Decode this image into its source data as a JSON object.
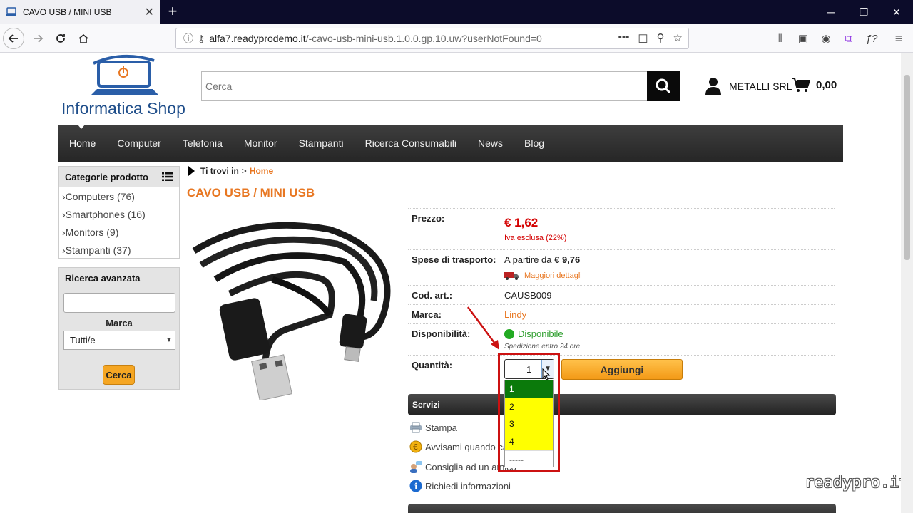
{
  "browser": {
    "tab_title": "CAVO USB / MINI USB",
    "tab_close": "✕",
    "new_tab": "+",
    "url_host": "alfa7.readyprodemo.it",
    "url_path": "/-cavo-usb-mini-usb.1.0.0.gp.10.uw?userNotFound=0",
    "url_menu": "•••"
  },
  "header": {
    "logo_text": "Informatica Shop",
    "search_placeholder": "Cerca",
    "user_name": "METALLI SRL",
    "cart_total": "0,00"
  },
  "menu": {
    "items": [
      "Home",
      "Computer",
      "Telefonia",
      "Monitor",
      "Stampanti",
      "Ricerca Consumabili",
      "News",
      "Blog"
    ]
  },
  "sidebar": {
    "categories_title": "Categorie prodotto",
    "categories": [
      "Computers (76)",
      "Smartphones (16)",
      "Monitors (9)",
      "Stampanti (37)"
    ],
    "advanced_title": "Ricerca avanzata",
    "brand_label": "Marca",
    "brand_value": "Tutti/e",
    "search_button": "Cerca"
  },
  "breadcrumb": {
    "prefix": "Ti trovi in",
    "sep": ">",
    "home": "Home"
  },
  "product": {
    "title": "CAVO USB / MINI USB",
    "price_label": "Prezzo:",
    "price": "€ 1,62",
    "vat_note": "Iva esclusa (22%)",
    "shipping_label": "Spese di trasporto:",
    "shipping_prefix": "A partire da",
    "shipping_value": "€ 9,76",
    "shipping_details": "Maggiori dettagli",
    "code_label": "Cod. art.:",
    "code": "CAUSB009",
    "brand_label": "Marca:",
    "brand": "Lindy",
    "availability_label": "Disponibilità:",
    "availability": "Disponibile",
    "ship_time": "Spedizione entro 24 ore",
    "qty_label": "Quantità:",
    "qty_value": "1",
    "add_button": "Aggiungi",
    "qty_options": [
      "1",
      "2",
      "3",
      "4",
      "-----"
    ]
  },
  "services": {
    "title": "Servizi",
    "items": [
      "Stampa",
      "Avvisami quando cala il prezzo",
      "Consiglia ad un amico",
      "Richiedi informazioni"
    ]
  },
  "watermark": "readypro.it",
  "colors": {
    "accent_orange": "#e87722",
    "price_red": "#d40000",
    "available_green": "#22aa22",
    "selected_option": "#0b7a0b",
    "option_bg": "#ffff00",
    "highlight_red": "#cc1111"
  }
}
